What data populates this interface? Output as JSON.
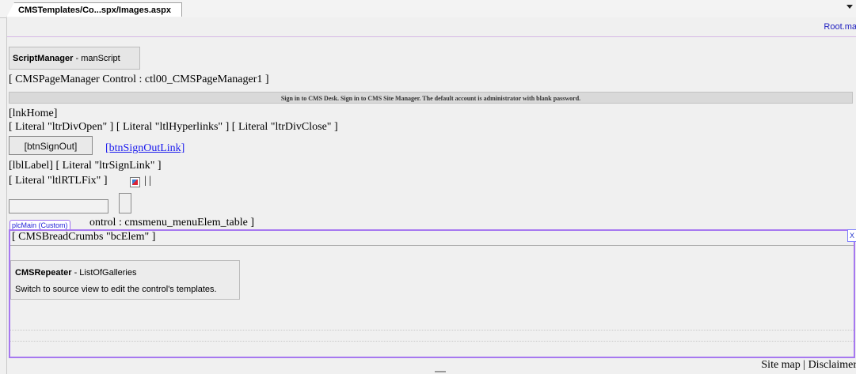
{
  "tab": {
    "title": "CMSTemplates/Co...spx/Images.aspx"
  },
  "root_link": "Root.ma",
  "script_manager": {
    "type": "ScriptManager",
    "name": " - manScript"
  },
  "page_manager": "[ CMSPageManager Control : ctl00_CMSPageManager1 ]",
  "signin_bar": "Sign in to CMS Desk. Sign in to CMS Site Manager. The default account is administrator with blank password.",
  "lnk_home": "[lnkHome]",
  "literals_line": "[ Literal \"ltrDivOpen\" ] [ Literal \"ltlHyperlinks\" ] [ Literal \"ltrDivClose\" ]",
  "btn_signout": "[btnSignOut]",
  "btn_signout_link": "[btnSignOutLink]",
  "label_line": "[lblLabel]  [ Literal \"ltrSignLink\" ]",
  "rtlfix_line": "[ Literal \"ltlRTLFix\" ]",
  "rtlfix_pipes": "|  |",
  "placeholder": {
    "label": "plcMain (Custom)",
    "overlap_text": "ontrol : cmsmenu_menuElem_table ]"
  },
  "breadcrumbs": "[ CMSBreadCrumbs \"bcElem\" ]",
  "close_label": "X",
  "repeater": {
    "type": "CMSRepeater",
    "name": " - ListOfGalleries",
    "hint": "Switch to source view to edit the control's templates."
  },
  "footer": "Site map | Disclaimer"
}
